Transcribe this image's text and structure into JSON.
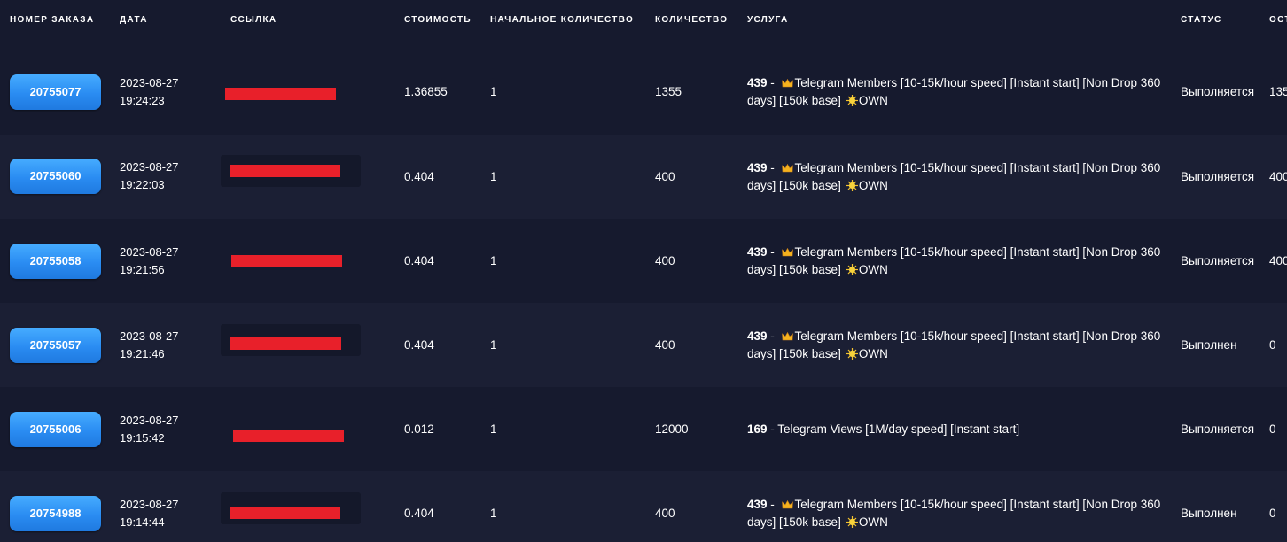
{
  "columns": {
    "order_id": "НОМЕР ЗАКАЗА",
    "date": "ДАТА",
    "link": "ССЫЛКА",
    "cost": "СТОИМОСТЬ",
    "start_count": "НАЧАЛЬНОЕ КОЛИЧЕСТВО",
    "quantity": "КОЛИЧЕСТВО",
    "service": "УСЛУГА",
    "status": "СТАТУС",
    "remains": "ОСТ"
  },
  "orders": [
    {
      "id": "20755077",
      "date": "2023-08-27",
      "time": "19:24:23",
      "cost": "1.36855",
      "start_count": "1",
      "quantity": "1355",
      "service_id": "439",
      "service_sep": " - ",
      "service_line1": "Telegram Members [10-15k/hour speed] [Instant start] [Non Drop 360",
      "service_line2": "days] [150k base]",
      "service_tag": "OWN",
      "status": "Выполняется",
      "remains": "135"
    },
    {
      "id": "20755060",
      "date": "2023-08-27",
      "time": "19:22:03",
      "cost": "0.404",
      "start_count": "1",
      "quantity": "400",
      "service_id": "439",
      "service_sep": " - ",
      "service_line1": "Telegram Members [10-15k/hour speed] [Instant start] [Non Drop 360",
      "service_line2": "days] [150k base]",
      "service_tag": "OWN",
      "status": "Выполняется",
      "remains": "400"
    },
    {
      "id": "20755058",
      "date": "2023-08-27",
      "time": "19:21:56",
      "cost": "0.404",
      "start_count": "1",
      "quantity": "400",
      "service_id": "439",
      "service_sep": " - ",
      "service_line1": "Telegram Members [10-15k/hour speed] [Instant start] [Non Drop 360",
      "service_line2": "days] [150k base]",
      "service_tag": "OWN",
      "status": "Выполняется",
      "remains": "400"
    },
    {
      "id": "20755057",
      "date": "2023-08-27",
      "time": "19:21:46",
      "cost": "0.404",
      "start_count": "1",
      "quantity": "400",
      "service_id": "439",
      "service_sep": " - ",
      "service_line1": "Telegram Members [10-15k/hour speed] [Instant start] [Non Drop 360",
      "service_line2": "days] [150k base]",
      "service_tag": "OWN",
      "status": "Выполнен",
      "remains": "0"
    },
    {
      "id": "20755006",
      "date": "2023-08-27",
      "time": "19:15:42",
      "cost": "0.012",
      "start_count": "1",
      "quantity": "12000",
      "service_id": "169",
      "service_sep": " - ",
      "service_line1": "Telegram Views [1M/day speed] [Instant start]",
      "service_line2": "",
      "service_tag": "",
      "status": "Выполняется",
      "remains": "0"
    },
    {
      "id": "20754988",
      "date": "2023-08-27",
      "time": "19:14:44",
      "cost": "0.404",
      "start_count": "1",
      "quantity": "400",
      "service_id": "439",
      "service_sep": " - ",
      "service_line1": "Telegram Members [10-15k/hour speed] [Instant start] [Non Drop 360",
      "service_line2": "days] [150k base]",
      "service_tag": "OWN",
      "status": "Выполнен",
      "remains": "0"
    }
  ],
  "colors": {
    "background": "#161a2e",
    "row_alt": "#1b1f34",
    "button": "#2a8cf2",
    "redaction": "#e8202a"
  },
  "icons": {
    "crown": "crown-icon",
    "sun": "sun-icon"
  }
}
